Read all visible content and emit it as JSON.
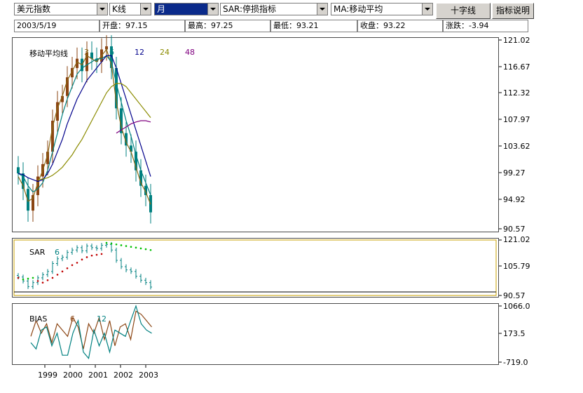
{
  "toolbar": {
    "instrument": "美元指数",
    "chart_type": "K线",
    "period": "月",
    "sar_indicator": "SAR:停损指标",
    "ma_indicator": "MA:移动平均",
    "crosshair_button": "十字线",
    "indicator_help_button": "指标说明"
  },
  "info_bar": {
    "date": "2003/5/19",
    "open": "开盘：97.15",
    "high": "最高：97.25",
    "low": "最低：93.21",
    "close": "收盘：93.22",
    "change": "涨跌：-3.94"
  },
  "main_panel": {
    "title": "移动平均线",
    "ma_labels": [
      "3",
      "6",
      "12",
      "24",
      "48"
    ],
    "y_ticks": [
      "121.02",
      "116.67",
      "112.32",
      "107.97",
      "103.62",
      "99.27",
      "94.92",
      "90.57"
    ]
  },
  "sar_panel": {
    "title": "SAR",
    "param": "6",
    "y_ticks": [
      "121.02",
      "105.79",
      "90.57"
    ]
  },
  "bias_panel": {
    "title": "BIAS",
    "params": [
      "6",
      "12"
    ],
    "y_ticks": [
      "1066.0",
      "173.5",
      "-719.0"
    ]
  },
  "x_axis": [
    "1999",
    "2000",
    "2001",
    "2002",
    "2003"
  ],
  "colors": {
    "candle": "#8b4513",
    "candle_down": "#008080",
    "ma3": "#8b6914",
    "ma6": "#008080",
    "ma12": "#00008b",
    "ma24": "#8b8b00",
    "ma48": "#800080",
    "sar_above": "#00c000",
    "sar_below": "#c00000",
    "bias6": "#8b4513",
    "bias12": "#008080",
    "panel_border": "#c8a000"
  },
  "chart_data": [
    {
      "type": "candlestick",
      "title": "移动平均线",
      "ylim": [
        90.57,
        121.02
      ],
      "x": [
        "1999",
        "2000",
        "2001",
        "2002",
        "2003"
      ],
      "close": [
        99.5,
        97.0,
        93.5,
        96.0,
        99.0,
        101.0,
        103.0,
        108.0,
        111.0,
        112.0,
        115.0,
        116.5,
        118.0,
        116.0,
        119.0,
        118.0,
        117.5,
        119.5,
        120.0,
        116.5,
        110.0,
        106.0,
        104.0,
        103.0,
        100.0,
        97.5,
        96.0,
        93.22
      ],
      "series": [
        {
          "name": "3",
          "values": [
            99,
            97.5,
            95,
            95.5,
            98,
            100,
            102.5,
            107,
            110,
            112,
            114.5,
            116,
            117.5,
            117,
            118.5,
            118,
            117.5,
            118.5,
            119.5,
            117,
            111,
            107,
            104.5,
            103,
            100.5,
            98,
            96.5,
            94.5
          ]
        },
        {
          "name": "6",
          "values": [
            99.5,
            99,
            97.5,
            96.5,
            97,
            98,
            100,
            103,
            106,
            109,
            111.5,
            113.5,
            115.5,
            116.5,
            117,
            117.5,
            118,
            118,
            118.5,
            117.5,
            114,
            111,
            108,
            105.5,
            102.5,
            100,
            98,
            96
          ]
        },
        {
          "name": "12",
          "values": [
            99.5,
            99.3,
            98.8,
            98.5,
            98.2,
            98.5,
            99.5,
            101,
            103,
            105,
            107.5,
            109.5,
            111.5,
            113,
            114.5,
            115.5,
            116.5,
            117.5,
            118.5,
            118.5,
            116.5,
            114,
            111.5,
            109,
            106.5,
            104,
            101.5,
            99
          ]
        },
        {
          "name": "24",
          "values": [
            null,
            null,
            null,
            null,
            98.5,
            98.6,
            98.8,
            99.2,
            99.8,
            100.5,
            101.5,
            102.5,
            103.8,
            105,
            106.5,
            108,
            109.5,
            111,
            112.5,
            113.5,
            114,
            114,
            113.5,
            112.5,
            111.5,
            110.5,
            109.5,
            108.5
          ]
        },
        {
          "name": "48",
          "values": [
            null,
            null,
            null,
            null,
            null,
            null,
            null,
            null,
            null,
            null,
            null,
            null,
            null,
            null,
            null,
            null,
            null,
            null,
            null,
            null,
            106,
            106.5,
            107,
            107.5,
            107.8,
            108,
            108,
            107.8
          ]
        }
      ]
    },
    {
      "type": "line",
      "title": "SAR",
      "ylim": [
        90.57,
        121.02
      ],
      "series": [
        {
          "name": "6",
          "values": [
            99,
            98,
            98.5,
            99,
            97,
            96,
            97.5,
            99,
            101,
            103,
            105,
            107,
            108.5,
            110.5,
            112,
            113,
            113.5,
            114,
            121,
            120.5,
            120,
            119.5,
            119,
            118.5,
            118,
            117.5,
            117,
            116.5
          ]
        }
      ]
    },
    {
      "type": "line",
      "title": "BIAS",
      "ylim": [
        -719.0,
        1066.0
      ],
      "series": [
        {
          "name": "6",
          "values": [
            100,
            600,
            200,
            500,
            -100,
            500,
            300,
            100,
            700,
            400,
            -300,
            500,
            200,
            700,
            0,
            600,
            -200,
            400,
            500,
            0,
            900,
            800,
            600,
            400
          ]
        },
        {
          "name": "12",
          "values": [
            -100,
            -300,
            300,
            400,
            -200,
            200,
            -500,
            -500,
            200,
            600,
            -400,
            -600,
            300,
            -200,
            200,
            -400,
            300,
            200,
            100,
            600,
            1066,
            500,
            300,
            200
          ]
        }
      ]
    }
  ]
}
